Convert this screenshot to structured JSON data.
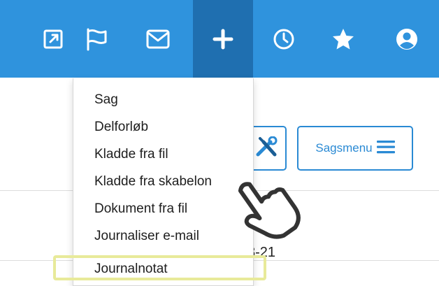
{
  "topbar": {
    "icons": [
      {
        "name": "external-link-icon"
      },
      {
        "name": "flag-icon"
      },
      {
        "name": "envelope-icon"
      },
      {
        "name": "plus-icon"
      },
      {
        "name": "clock-icon"
      },
      {
        "name": "star-icon"
      },
      {
        "name": "user-icon"
      }
    ],
    "accent_color": "#2f93dd",
    "active_color": "#1f6fb0"
  },
  "new_menu": {
    "items": [
      {
        "label": "Sag"
      },
      {
        "label": "Delforløb"
      },
      {
        "label": "Kladde fra fil"
      },
      {
        "label": "Kladde fra skabelon"
      },
      {
        "label": "Dokument fra fil"
      },
      {
        "label": "Journaliser e-mail"
      },
      {
        "label": "Journalnotat"
      }
    ],
    "highlighted_item": "Journalnotat"
  },
  "toolbar": {
    "tools_icon": "tools-icon",
    "sagsmenu_label": "Sagsmenu",
    "sagsmenu_icon": "hamburger-icon"
  },
  "main": {
    "partial_text": "8-21"
  }
}
